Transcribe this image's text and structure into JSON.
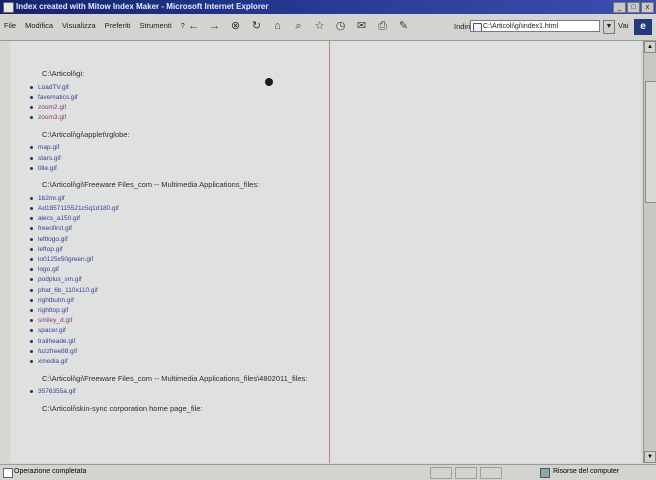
{
  "window": {
    "title": "Index created with Mitow Index Maker - Microsoft Internet Explorer",
    "controls": [
      "_",
      "□",
      "x"
    ]
  },
  "menu": [
    "File",
    "Modifica",
    "Visualizza",
    "Preferiti",
    "Strumenti",
    "?"
  ],
  "toolbar": {
    "address_label": "Indirizzo",
    "address_value": "C:\\Articoli\\gi\\index1.html",
    "go_label": "Vai"
  },
  "sections": [
    {
      "title": "C:\\Articoli\\gi:",
      "files": [
        {
          "name": "LoadTV.gif",
          "visited": false
        },
        {
          "name": "favematics.gif",
          "visited": false
        },
        {
          "name": "zoom2.gif",
          "visited": true
        },
        {
          "name": "zoom3.gif",
          "visited": true
        }
      ]
    },
    {
      "title": "C:\\Articoli\\gi\\applet\\rglobe:",
      "files": [
        {
          "name": "map.gif",
          "visited": false
        },
        {
          "name": "stars.gif",
          "visited": false
        },
        {
          "name": "title.gif",
          "visited": false
        }
      ]
    },
    {
      "title": "C:\\Articoli\\gi\\Freeware Files_com -- Multimedia Applications_files:",
      "files": [
        {
          "name": "1b2mr.gif",
          "visited": false
        },
        {
          "name": "Ad1857115521c5q1d180.gif",
          "visited": false
        },
        {
          "name": "alecs_a150.gif",
          "visited": false
        },
        {
          "name": "freeofirst.gif",
          "visited": false
        },
        {
          "name": "leftlogo.gif",
          "visited": false
        },
        {
          "name": "leftop.gif",
          "visited": false
        },
        {
          "name": "lo0125x50green.gif",
          "visited": false
        },
        {
          "name": "logo.gif",
          "visited": false
        },
        {
          "name": "podplus_sm.gif",
          "visited": false
        },
        {
          "name": "phat_6b_110x110.gif",
          "visited": false
        },
        {
          "name": "rightbutm.gif",
          "visited": false
        },
        {
          "name": "righttop.gif",
          "visited": false
        },
        {
          "name": "smiley_d.gif",
          "visited": true
        },
        {
          "name": "spacer.gif",
          "visited": false
        },
        {
          "name": "trailheade.gif",
          "visited": false
        },
        {
          "name": "fuzzfree88.gif",
          "visited": false
        },
        {
          "name": "xmedia.gif",
          "visited": false
        }
      ]
    },
    {
      "title": "C:\\Articoli\\gi\\Freeware Files_com -- Multimedia Applications_files\\4802011_files:",
      "files": [
        {
          "name": "3576355a.gif",
          "visited": false
        }
      ]
    },
    {
      "title": "C:\\Articoli\\skin-sync corporation home page_file:",
      "files": []
    }
  ],
  "status": {
    "left": "Operazione completata",
    "right": "Risorse del computer"
  },
  "colors": {
    "titlebar": "#14236e",
    "link": "#3a3f92",
    "visited_link": "#8a3d6a",
    "content_bg": "#dfe0e0"
  }
}
